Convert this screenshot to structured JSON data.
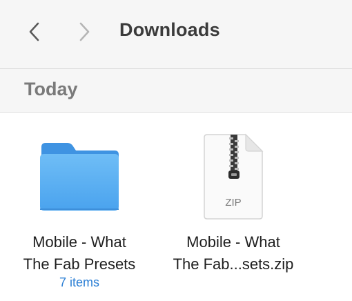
{
  "toolbar": {
    "back_icon": "chevron-left-icon",
    "forward_icon": "chevron-right-icon",
    "title": "Downloads"
  },
  "section": {
    "title": "Today"
  },
  "files": [
    {
      "kind": "folder",
      "icon": "folder-icon",
      "name_line1": "Mobile - What",
      "name_line2": "The Fab Presets",
      "subtitle": "7 items"
    },
    {
      "kind": "zip",
      "icon": "zip-file-icon",
      "icon_label": "ZIP",
      "name_line1": "Mobile - What",
      "name_line2": "The Fab...sets.zip"
    }
  ],
  "colors": {
    "folder": "#4ea8f0",
    "subtitle": "#2a7ed4",
    "toolbar_bg": "#f6f6f6"
  }
}
